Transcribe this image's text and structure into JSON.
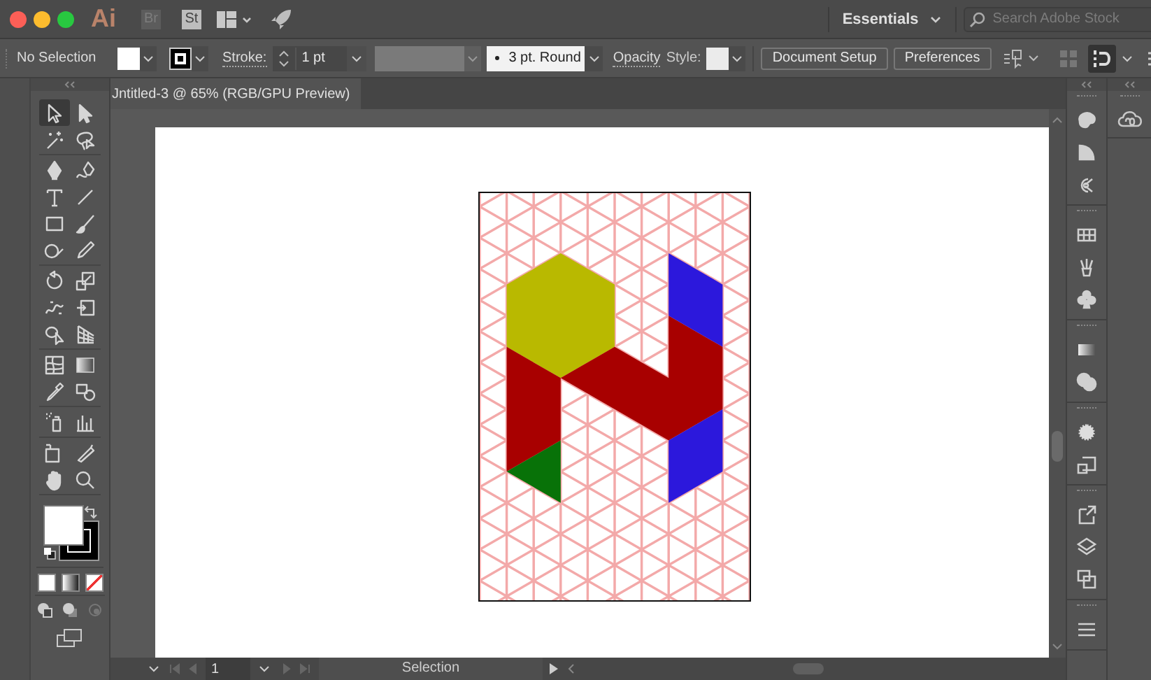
{
  "app_bar": {
    "logo": "Ai",
    "bridge": "Br",
    "stock": "St",
    "workspace": "Essentials",
    "search": {
      "placeholder": "Search Adobe Stock"
    }
  },
  "control_bar": {
    "selection": "No Selection",
    "stroke_label": "Stroke:",
    "stroke_weight": "1 pt",
    "brush": "3 pt. Round",
    "opacity_label": "Opacity",
    "style_label": "Style:",
    "buttons": [
      "Document Setup",
      "Preferences"
    ]
  },
  "document_tab": {
    "title": "Jntitled-3 @ 65% (RGB/GPU Preview)"
  },
  "tools": [
    [
      {
        "kind": "selection",
        "selected": true
      },
      {
        "kind": "direct-selection",
        "selected": false
      },
      {
        "kind": "magic-wand",
        "selected": false
      },
      {
        "kind": "lasso",
        "selected": false
      }
    ],
    [
      {
        "kind": "pen",
        "selected": false
      },
      {
        "kind": "curvature",
        "selected": false
      },
      {
        "kind": "type",
        "selected": false
      },
      {
        "kind": "line",
        "selected": false
      },
      {
        "kind": "rectangle",
        "selected": false
      },
      {
        "kind": "paintbrush",
        "selected": false
      },
      {
        "kind": "shaper",
        "selected": false
      },
      {
        "kind": "pencil",
        "selected": false
      }
    ],
    [
      {
        "kind": "rotate",
        "selected": false
      },
      {
        "kind": "scale",
        "selected": false
      },
      {
        "kind": "puppet-warp",
        "selected": false
      },
      {
        "kind": "free-transform",
        "selected": false
      },
      {
        "kind": "shape-builder",
        "selected": false
      },
      {
        "kind": "perspective-grid",
        "selected": false
      }
    ],
    [
      {
        "kind": "mesh",
        "selected": false
      },
      {
        "kind": "gradient",
        "selected": false
      },
      {
        "kind": "eyedropper",
        "selected": false
      },
      {
        "kind": "blend",
        "selected": false
      }
    ],
    [
      {
        "kind": "symbol-sprayer",
        "selected": false
      },
      {
        "kind": "column-graph",
        "selected": false
      }
    ],
    [
      {
        "kind": "artboard",
        "selected": false
      },
      {
        "kind": "slice",
        "selected": false
      },
      {
        "kind": "hand",
        "selected": false
      },
      {
        "kind": "zoom",
        "selected": false
      }
    ]
  ],
  "status_bar": {
    "artboard": "1",
    "tool": "Selection"
  }
}
